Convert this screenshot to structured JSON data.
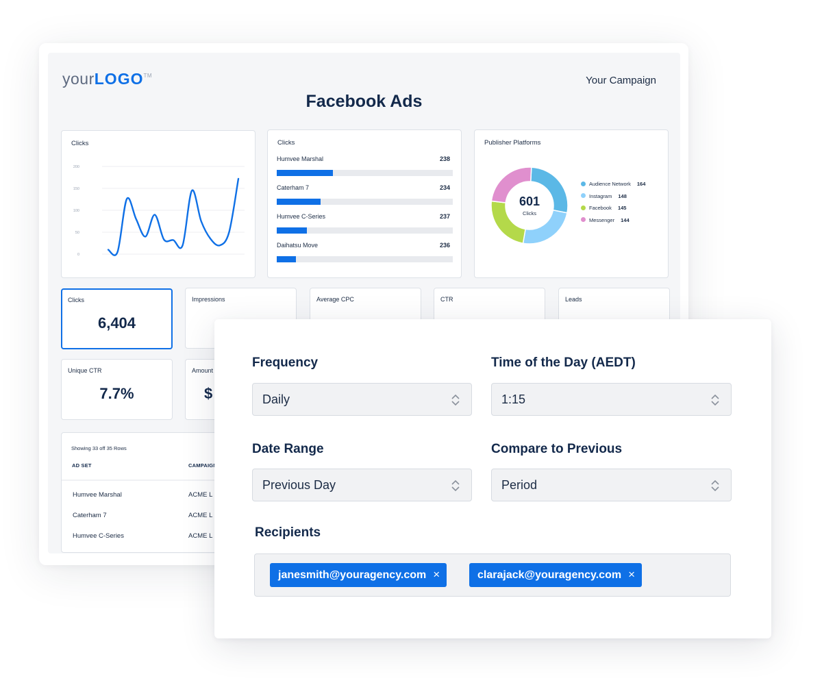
{
  "report": {
    "logo": {
      "prefix": "your",
      "brand": "LOGO",
      "tm": "TM"
    },
    "campaign": "Your Campaign",
    "title": "Facebook Ads"
  },
  "line_card": {
    "title": "Clicks",
    "chart_data": {
      "type": "line",
      "title": "Clicks",
      "xlabel": "",
      "ylabel": "",
      "ylim": [
        0,
        200
      ],
      "yticks": [
        "200",
        "150",
        "100",
        "50",
        "0"
      ],
      "grid": true,
      "series": [
        {
          "name": "Clicks",
          "color": "#0f70e6",
          "values": [
            10,
            5,
            126,
            80,
            40,
            90,
            33,
            32,
            20,
            145,
            75,
            35,
            20,
            50,
            172
          ]
        }
      ]
    }
  },
  "bar_card": {
    "title": "Clicks",
    "chart_data": {
      "type": "bar",
      "orientation": "horizontal",
      "categories": [
        "Humvee Marshal",
        "Caterham 7",
        "Humvee C-Series",
        "Daihatsu Move"
      ],
      "values": [
        238,
        234,
        237,
        236
      ],
      "fill_fraction": [
        0.32,
        0.25,
        0.17,
        0.11
      ],
      "color": "#0f70e6",
      "track_color": "#e8eaee"
    }
  },
  "donut_card": {
    "title": "Publisher Platforms",
    "center_value": "601",
    "center_label": "Clicks",
    "chart_data": {
      "type": "pie",
      "donut": true,
      "categories": [
        "Audience Network",
        "Instagram",
        "Facebook",
        "Messenger"
      ],
      "values": [
        164,
        148,
        145,
        144
      ],
      "colors": [
        "#5bb8e6",
        "#8fd1fb",
        "#b4d94a",
        "#e08fce"
      ],
      "total": 601,
      "legend": "right"
    }
  },
  "kpis": [
    {
      "label": "Clicks",
      "value": "6,404",
      "selected": true
    },
    {
      "label": "Impressions",
      "value": "",
      "selected": false
    },
    {
      "label": "Average CPC",
      "value": "",
      "selected": false
    },
    {
      "label": "CTR",
      "value": "",
      "selected": false
    },
    {
      "label": "Leads",
      "value": "",
      "selected": false
    },
    {
      "label": "Unique CTR",
      "value": "7.7%",
      "selected": false
    },
    {
      "label": "Amount",
      "value": "$",
      "selected": false
    }
  ],
  "table": {
    "caption": "Showing 33 off 35 Rows",
    "columns": [
      "AD SET",
      "CAMPAIGN"
    ],
    "rows": [
      [
        "Humvee Marshal",
        "ACME L"
      ],
      [
        "Caterham 7",
        "ACME L"
      ],
      [
        "Humvee C-Series",
        "ACME L"
      ]
    ]
  },
  "schedule": {
    "frequency": {
      "label": "Frequency",
      "value": "Daily"
    },
    "time_of_day": {
      "label": "Time of the Day (AEDT)",
      "value": "1:15"
    },
    "date_range": {
      "label": "Date Range",
      "value": "Previous Day"
    },
    "compare": {
      "label": "Compare to Previous",
      "value": "Period"
    },
    "recipients": {
      "label": "Recipients",
      "chips": [
        "janesmith@youragency.com",
        "clarajack@youragency.com"
      ],
      "remove_glyph": "×"
    }
  },
  "colors": {
    "accent": "#0f70e6",
    "navy_text": "#13294b",
    "panel_bg": "#f5f6f8"
  }
}
